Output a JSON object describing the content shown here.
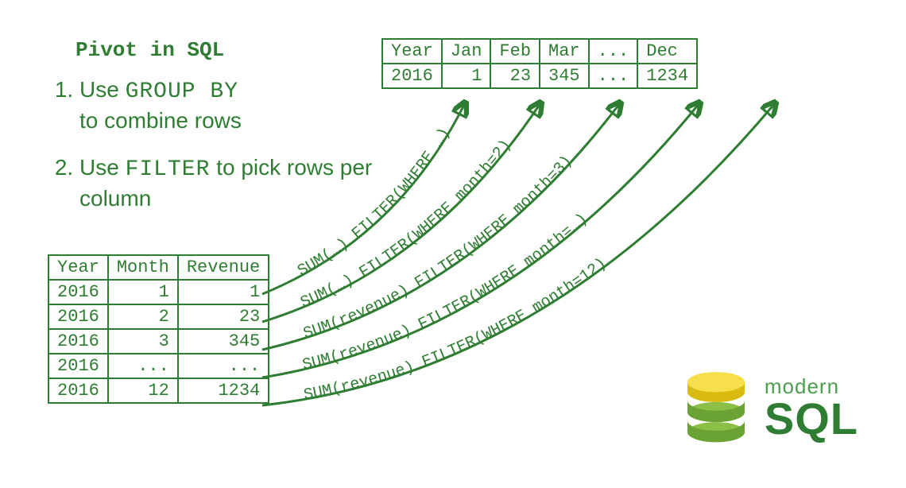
{
  "title": "Pivot in SQL",
  "steps": [
    {
      "pre": "Use ",
      "kw": "GROUP BY",
      "post": " to combine rows"
    },
    {
      "pre": "Use ",
      "kw": "FILTER",
      "post": " to pick rows per column"
    }
  ],
  "src_headers": [
    "Year",
    "Month",
    "Revenue"
  ],
  "src_rows": [
    [
      "2016",
      "1",
      "1"
    ],
    [
      "2016",
      "2",
      "23"
    ],
    [
      "2016",
      "3",
      "345"
    ],
    [
      "2016",
      "...",
      "..."
    ],
    [
      "2016",
      "12",
      "1234"
    ]
  ],
  "dst_headers": [
    "Year",
    "Jan",
    "Feb",
    "Mar",
    "...",
    "Dec"
  ],
  "dst_row": [
    "2016",
    "1",
    "23",
    "345",
    "...",
    "1234"
  ],
  "arrow_labels": [
    "SUM(…) FILTER(WHERE …)",
    "SUM(…) FILTER(WHERE month=2)",
    "SUM(revenue) FILTER(WHERE month=3)",
    "SUM(revenue) FILTER(WHERE month=…)",
    "SUM(revenue) FILTER(WHERE month=12)"
  ],
  "logo": {
    "top": "modern",
    "bottom": "SQL"
  }
}
